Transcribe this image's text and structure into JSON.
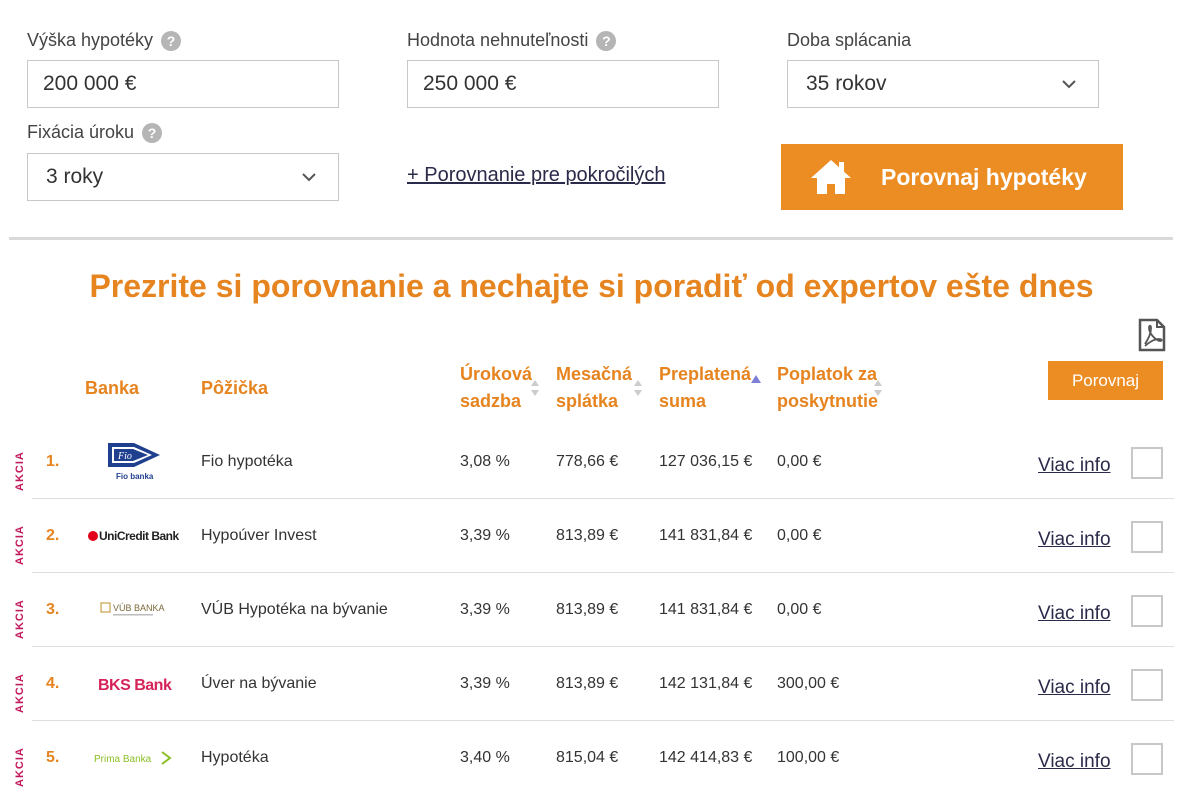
{
  "form": {
    "loan_amount_label": "Výška hypotéky",
    "loan_amount_value": "200 000 €",
    "property_value_label": "Hodnota nehnuteľnosti",
    "property_value_value": "250 000 €",
    "term_label": "Doba splácania",
    "term_value": "35 rokov",
    "fixation_label": "Fixácia úroku",
    "fixation_value": "3 roky",
    "help_symbol": "?",
    "advanced_link": "+ Porovnanie pre pokročilých",
    "compare_button": "Porovnaj hypotéky"
  },
  "headline": "Prezrite si porovnanie a nechajte si poradiť od expertov ešte dnes",
  "table": {
    "headers": {
      "bank": "Banka",
      "loan": "Pôžička",
      "rate_line1": "Úroková",
      "rate_line2": "sadzba",
      "monthly_line1": "Mesačná",
      "monthly_line2": "splátka",
      "overpaid_line1": "Preplatená",
      "overpaid_line2": "suma",
      "fee_line1": "Poplatok za",
      "fee_line2": "poskytnutie"
    },
    "compare_button": "Porovnaj",
    "badge": "AKCIA",
    "more_info": "Viac info",
    "rows": [
      {
        "rank": "1.",
        "bank": "Fio banka",
        "loan": "Fio hypotéka",
        "rate": "3,08 %",
        "monthly": "778,66 €",
        "overpaid": "127 036,15 €",
        "fee": "0,00 €"
      },
      {
        "rank": "2.",
        "bank": "UniCredit Bank",
        "loan": "Hypoúver Invest",
        "rate": "3,39 %",
        "monthly": "813,89 €",
        "overpaid": "141 831,84 €",
        "fee": "0,00 €"
      },
      {
        "rank": "3.",
        "bank": "VÚB BANKA",
        "loan": "VÚB Hypotéka na bývanie",
        "rate": "3,39 %",
        "monthly": "813,89 €",
        "overpaid": "141 831,84 €",
        "fee": "0,00 €"
      },
      {
        "rank": "4.",
        "bank": "BKS Bank",
        "loan": "Úver na bývanie",
        "rate": "3,39 %",
        "monthly": "813,89 €",
        "overpaid": "142 131,84 €",
        "fee": "300,00 €"
      },
      {
        "rank": "5.",
        "bank": "Prima Banka",
        "loan": "Hypotéka",
        "rate": "3,40 %",
        "monthly": "815,04 €",
        "overpaid": "142 414,83 €",
        "fee": "100,00 €"
      }
    ]
  },
  "colors": {
    "accent": "#ec8d24",
    "heading": "#e68420",
    "badge": "#c2185b"
  }
}
